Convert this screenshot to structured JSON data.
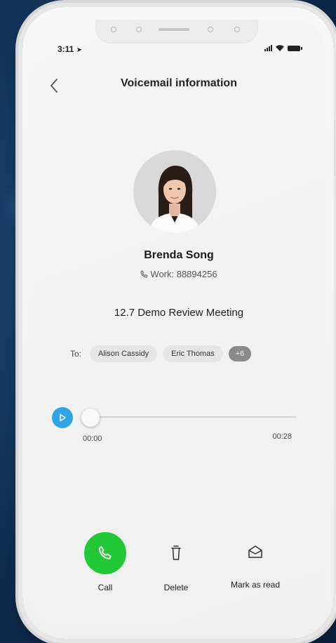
{
  "status_bar": {
    "time": "3:11"
  },
  "header": {
    "title": "Voicemail information"
  },
  "contact": {
    "name": "Brenda Song",
    "phone": "Work: 88894256"
  },
  "voicemail": {
    "title": "12.7 Demo Review Meeting",
    "to_label": "To:",
    "recipients": [
      "Alison Cassidy",
      "Eric Thomas"
    ],
    "more_count": "+6"
  },
  "player": {
    "current_time": "00:00",
    "duration": "00:28",
    "progress_percent": 0
  },
  "actions": {
    "call": "Call",
    "delete": "Delete",
    "mark_read": "Mark as read"
  },
  "colors": {
    "call_green": "#23c836",
    "play_blue": "#2ea6e6",
    "background_navy": "#163c66"
  },
  "icons": {
    "back": "chevron-left-icon",
    "phone": "phone-icon",
    "trash": "trash-icon",
    "envelope": "envelope-open-icon",
    "play": "play-icon"
  }
}
